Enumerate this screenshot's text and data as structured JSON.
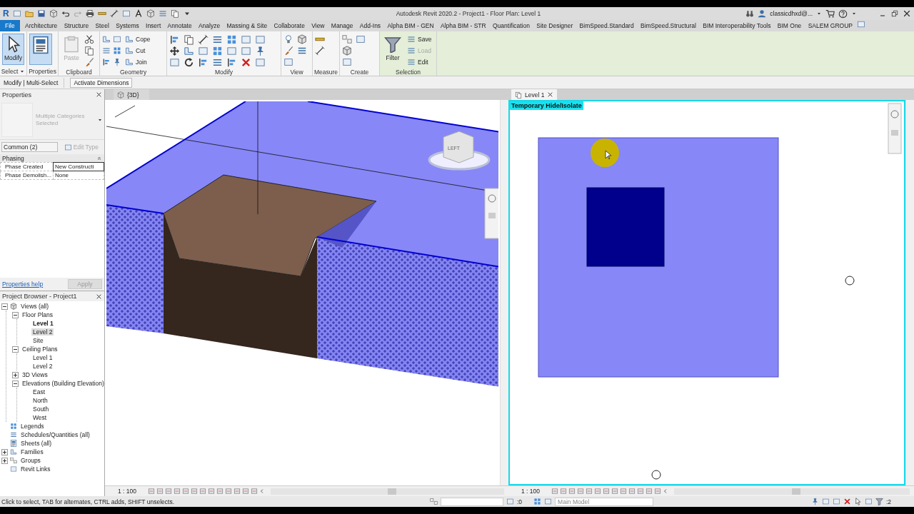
{
  "window": {
    "logo": "R",
    "title": "Autodesk Revit 2020.2 - Project1 - Floor Plan: Level 1",
    "user": "classicdhxd@..."
  },
  "ribbon_tabs": [
    {
      "label": "File",
      "kind": "app",
      "selected": false
    },
    {
      "label": "Architecture",
      "kind": "tab",
      "selected": false
    },
    {
      "label": "Structure",
      "kind": "tab",
      "selected": false
    },
    {
      "label": "Steel",
      "kind": "tab",
      "selected": false
    },
    {
      "label": "Systems",
      "kind": "tab",
      "selected": false
    },
    {
      "label": "Insert",
      "kind": "tab",
      "selected": false
    },
    {
      "label": "Annotate",
      "kind": "tab",
      "selected": false
    },
    {
      "label": "Analyze",
      "kind": "tab",
      "selected": false
    },
    {
      "label": "Massing & Site",
      "kind": "tab",
      "selected": false
    },
    {
      "label": "Collaborate",
      "kind": "tab",
      "selected": false
    },
    {
      "label": "View",
      "kind": "tab",
      "selected": false
    },
    {
      "label": "Manage",
      "kind": "tab",
      "selected": false
    },
    {
      "label": "Add-Ins",
      "kind": "tab",
      "selected": false
    },
    {
      "label": "Alpha BIM - GEN",
      "kind": "tab",
      "selected": false
    },
    {
      "label": "Alpha BIM - STR",
      "kind": "tab",
      "selected": false
    },
    {
      "label": "Quantification",
      "kind": "tab",
      "selected": false
    },
    {
      "label": "Site Designer",
      "kind": "tab",
      "selected": false
    },
    {
      "label": "BimSpeed.Standard",
      "kind": "tab",
      "selected": false
    },
    {
      "label": "BimSpeed.Structural",
      "kind": "tab",
      "selected": false
    },
    {
      "label": "BIM Interoperability Tools",
      "kind": "tab",
      "selected": false
    },
    {
      "label": "BIM One",
      "kind": "tab",
      "selected": false
    },
    {
      "label": "SALEM GROUP",
      "kind": "tab",
      "selected": false
    }
  ],
  "ribbon_panels": [
    {
      "title": "Select",
      "tools": [
        {
          "label": "Modify",
          "kind": "large",
          "selected": true,
          "disabled": false
        }
      ]
    },
    {
      "title": "Properties"
    },
    {
      "title": "Clipboard",
      "tools": [
        {
          "label": "Paste",
          "kind": "large",
          "selected": false,
          "disabled": true
        }
      ]
    },
    {
      "title": "Geometry",
      "tools": [
        {
          "label": "Cope",
          "kind": "small",
          "disabled": false
        },
        {
          "label": "Cut",
          "kind": "small",
          "disabled": false
        },
        {
          "label": "Join",
          "kind": "small",
          "disabled": false
        }
      ]
    },
    {
      "title": "Modify"
    },
    {
      "title": "View"
    },
    {
      "title": "Measure"
    },
    {
      "title": "Create"
    },
    {
      "title": "Selection",
      "tools": [
        {
          "label": "Filter",
          "kind": "large",
          "selected": false,
          "disabled": false
        },
        {
          "label": "Save",
          "kind": "small",
          "disabled": false
        },
        {
          "label": "Load",
          "kind": "small",
          "disabled": true
        },
        {
          "label": "Edit",
          "kind": "small",
          "disabled": false
        }
      ]
    }
  ],
  "options_bar": {
    "context": "Modify | Multi-Select",
    "button": "Activate Dimensions"
  },
  "properties": {
    "title": "Properties",
    "type_name": "Multiple Categories Selected",
    "filter": "Common (2)",
    "edit_type": {
      "label": "Edit Type",
      "disabled": true
    },
    "group": "Phasing",
    "rows": [
      {
        "name": "Phase Created",
        "value": "New Constructi",
        "editing": true
      },
      {
        "name": "Phase Demolish...",
        "value": "None",
        "editing": false
      }
    ],
    "help_link": "Properties help",
    "apply": {
      "label": "Apply",
      "disabled": true
    }
  },
  "project_browser": {
    "title": "Project Browser - Project1",
    "tree": [
      {
        "label": "Views (all)",
        "expanded": true,
        "selected": false,
        "current": false,
        "children": [
          {
            "label": "Floor Plans",
            "expanded": true,
            "selected": false,
            "current": false,
            "children": [
              {
                "label": "Level 1",
                "selected": false,
                "current": true
              },
              {
                "label": "Level 2",
                "selected": true,
                "current": false
              },
              {
                "label": "Site",
                "selected": false,
                "current": false
              }
            ]
          },
          {
            "label": "Ceiling Plans",
            "expanded": true,
            "selected": false,
            "current": false,
            "children": [
              {
                "label": "Level 1",
                "selected": false,
                "current": false
              },
              {
                "label": "Level 2",
                "selected": false,
                "current": false
              }
            ]
          },
          {
            "label": "3D Views",
            "expanded": false,
            "selected": false,
            "current": false
          },
          {
            "label": "Elevations (Building Elevation)",
            "expanded": true,
            "selected": false,
            "current": false,
            "children": [
              {
                "label": "East",
                "selected": false,
                "current": false
              },
              {
                "label": "North",
                "selected": false,
                "current": false
              },
              {
                "label": "South",
                "selected": false,
                "current": false
              },
              {
                "label": "West",
                "selected": false,
                "current": false
              }
            ]
          }
        ]
      },
      {
        "label": "Legends",
        "selected": false,
        "current": false
      },
      {
        "label": "Schedules/Quantities (all)",
        "selected": false,
        "current": false
      },
      {
        "label": "Sheets (all)",
        "selected": false,
        "current": false
      },
      {
        "label": "Families",
        "expanded": false,
        "selected": false,
        "current": false
      },
      {
        "label": "Groups",
        "expanded": false,
        "selected": false,
        "current": false
      },
      {
        "label": "Revit Links",
        "selected": false,
        "current": false
      }
    ]
  },
  "views": [
    {
      "kind": "model",
      "tab": "{3D}",
      "active": false,
      "view_cube": "LEFT",
      "scale": "1 : 100"
    },
    {
      "kind": "plan",
      "tab": "Level 1",
      "active": true,
      "banner": "Temporary Hide/Isolate",
      "scale": "1 : 100"
    }
  ],
  "status_bar": {
    "prompt": "Click to select, TAB for alternates, CTRL adds, SHIFT unselects.",
    "workset_count": ":0",
    "model": "Main Model",
    "filter_count": ":2"
  }
}
